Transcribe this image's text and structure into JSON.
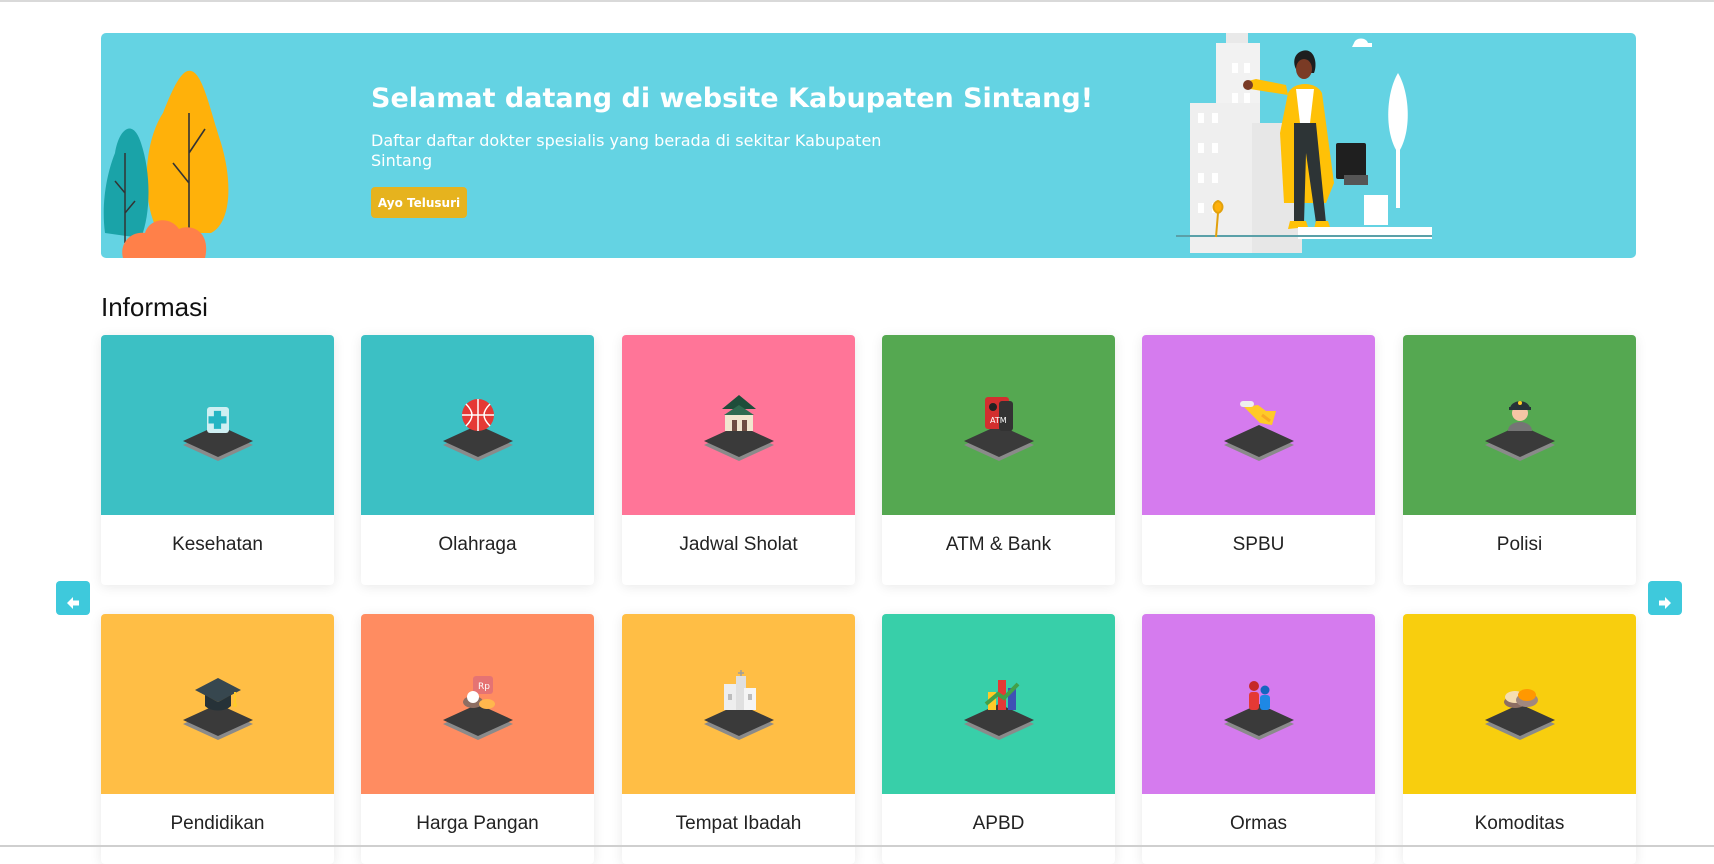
{
  "banner": {
    "title": "Selamat datang di website Kabupaten Sintang!",
    "subtitle": "Daftar daftar dokter spesialis yang berada di sekitar Kabupaten Sintang",
    "button_label": "Ayo Telusuri",
    "background_color": "#64d3e3",
    "button_color": "#e6b31e"
  },
  "section": {
    "title": "Informasi"
  },
  "cards": [
    {
      "label": "Kesehatan",
      "color": "#3cc0c4",
      "icon": "health-icon"
    },
    {
      "label": "Olahraga",
      "color": "#3cc0c4",
      "icon": "basketball-icon"
    },
    {
      "label": "Jadwal Sholat",
      "color": "#ff7598",
      "icon": "mosque-icon"
    },
    {
      "label": "ATM & Bank",
      "color": "#55a851",
      "icon": "atm-icon"
    },
    {
      "label": "SPBU",
      "color": "#d57bee",
      "icon": "fuel-nozzle-icon"
    },
    {
      "label": "Polisi",
      "color": "#55a851",
      "icon": "police-icon"
    },
    {
      "label": "Pendidikan",
      "color": "#ffbe45",
      "icon": "graduation-cap-icon"
    },
    {
      "label": "Harga Pangan",
      "color": "#ff8c61",
      "icon": "food-price-icon"
    },
    {
      "label": "Tempat Ibadah",
      "color": "#ffbe45",
      "icon": "worship-place-icon"
    },
    {
      "label": "APBD",
      "color": "#38cfa9",
      "icon": "bar-chart-icon"
    },
    {
      "label": "Ormas",
      "color": "#d57bee",
      "icon": "people-icon"
    },
    {
      "label": "Komoditas",
      "color": "#f8ce0e",
      "icon": "commodity-icon"
    }
  ],
  "navigation": {
    "prev_icon": "arrow-left-icon",
    "next_icon": "arrow-right-icon",
    "arrow_color": "#3ec9dc"
  }
}
